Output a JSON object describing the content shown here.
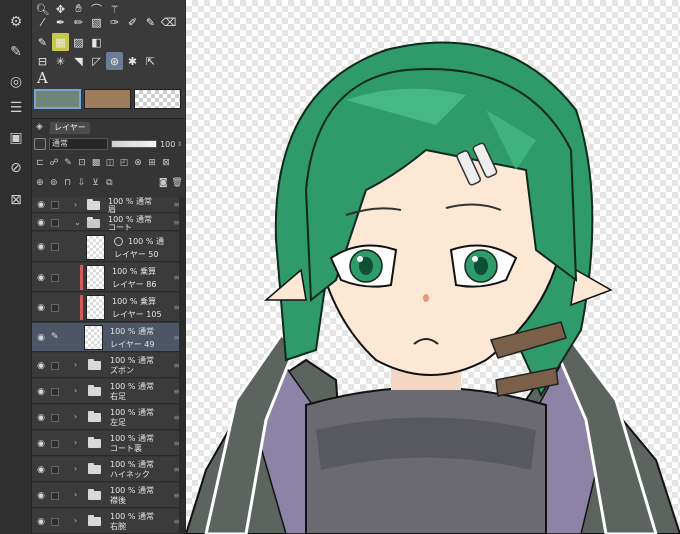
{
  "colors": {
    "main_color": "#6f8577",
    "sub_color": "#9c7c5b",
    "hair": "#2f9a6a",
    "skin": "#fde8d6",
    "coat": "#5d6460",
    "coat_lining": "#8d83a6"
  },
  "tools": {
    "text_tool_label": "A"
  },
  "layer_panel": {
    "tab_label": "レイヤー",
    "blend_mode": "通常",
    "opacity": "100"
  },
  "layers": [
    {
      "opacity_mode": "100 % 通常",
      "name": "眉",
      "kind": "folder",
      "expanded": false
    },
    {
      "opacity_mode": "100 % 通常",
      "name": "コート",
      "kind": "folder",
      "expanded": true
    },
    {
      "opacity_mode": "100 % 通",
      "name": "レイヤー 50",
      "kind": "raster",
      "clipped": false
    },
    {
      "opacity_mode": "100 % 乗算",
      "name": "レイヤー 86",
      "kind": "raster",
      "clipped": true
    },
    {
      "opacity_mode": "100 % 乗算",
      "name": "レイヤー 105",
      "kind": "raster",
      "clipped": true
    },
    {
      "opacity_mode": "100 % 通常",
      "name": "レイヤー 49",
      "kind": "raster",
      "selected": true
    },
    {
      "opacity_mode": "100 % 通常",
      "name": "ズボン",
      "kind": "folder"
    },
    {
      "opacity_mode": "100 % 通常",
      "name": "右足",
      "kind": "folder"
    },
    {
      "opacity_mode": "100 % 通常",
      "name": "左足",
      "kind": "folder"
    },
    {
      "opacity_mode": "100 % 通常",
      "name": "コート裏",
      "kind": "folder"
    },
    {
      "opacity_mode": "100 % 通常",
      "name": "ハイネック",
      "kind": "folder"
    },
    {
      "opacity_mode": "100 % 通常",
      "name": "襟後",
      "kind": "folder"
    },
    {
      "opacity_mode": "100 % 通常",
      "name": "右腕",
      "kind": "folder"
    },
    {
      "opacity_mode": "100 % 通常",
      "name": "",
      "kind": "folder"
    }
  ]
}
